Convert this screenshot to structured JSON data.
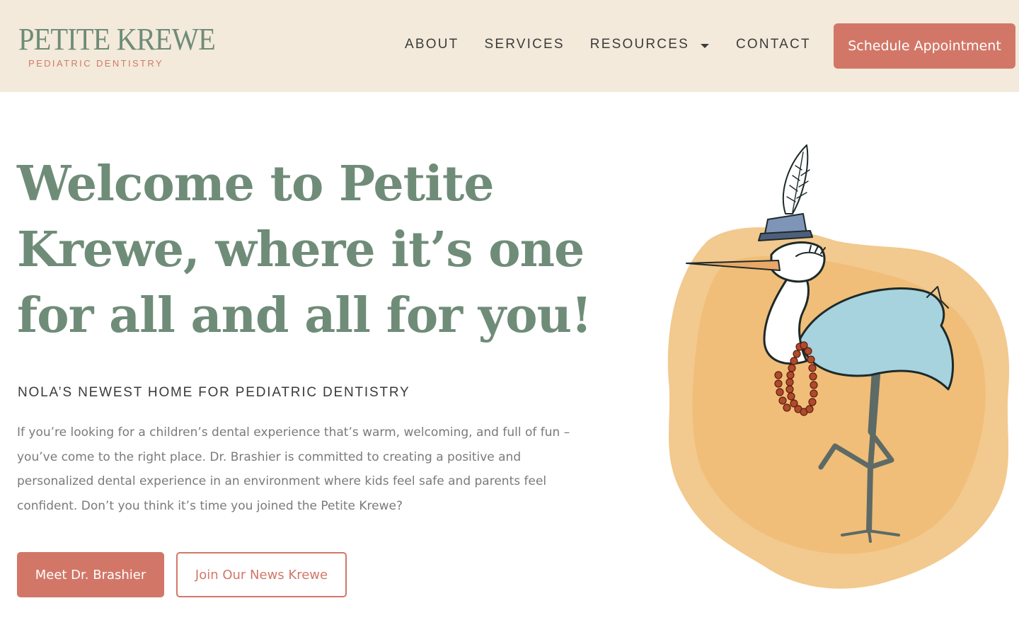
{
  "colors": {
    "header_bg": "#f3eadb",
    "brand_green": "#6f8c78",
    "brand_coral": "#d27768",
    "nav_text": "#3c3c3c",
    "body_text": "#7a7a7a",
    "watercolor": "#f0c07a"
  },
  "header": {
    "logo": {
      "title": "PETITE KREWE",
      "subtitle": "PEDIATRIC DENTISTRY"
    },
    "nav": {
      "about": "ABOUT",
      "services": "SERVICES",
      "resources": "RESOURCES",
      "contact": "CONTACT",
      "resources_icon": "chevron-down-icon"
    },
    "cta_label": "Schedule Appointment"
  },
  "hero": {
    "title": "Welcome to Petite Krewe, where it’s one for all and all for you!",
    "subtitle": "NOLA’S NEWEST HOME FOR PEDIATRIC DENTISTRY",
    "body": "If you’re looking for a children’s dental experience that’s warm, welcoming, and full of fun – you’ve come to the right place. Dr. Brashier is committed to creating a positive and personalized dental experience in an environment where kids feel safe and parents feel confident. Don’t you think it’s time you joined the Petite Krewe?",
    "primary_button": "Meet Dr. Brashier",
    "secondary_button": "Join Our News Krewe",
    "illustration": "heron-mascot-illustration"
  }
}
